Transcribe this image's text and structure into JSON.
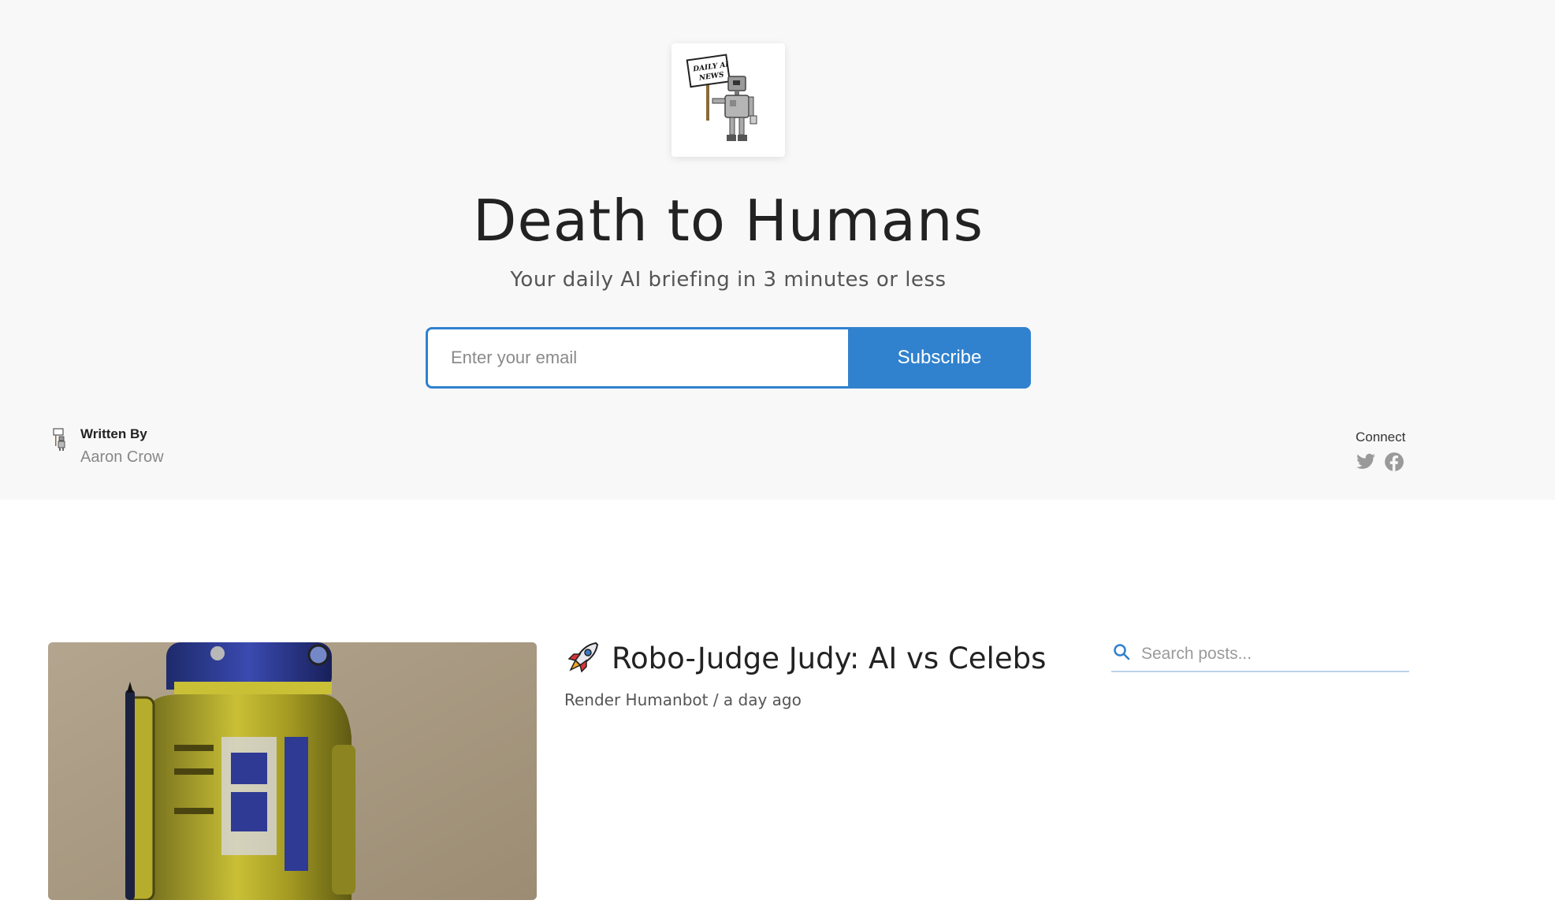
{
  "publication": {
    "logo": {
      "icon": "robot-holding-sign-logo",
      "sign_text": "DAILY AI NEWS"
    },
    "title": "Death to Humans",
    "tagline": "Your daily AI briefing in 3 minutes or less"
  },
  "subscribe": {
    "email_placeholder": "Enter your email",
    "email_value": "",
    "button_label": "Subscribe",
    "accent_color": "#3182ce"
  },
  "author": {
    "label": "Written By",
    "name": "Aaron Crow",
    "avatar_icon": "robot-avatar"
  },
  "connect": {
    "label": "Connect",
    "icons": [
      "twitter-icon",
      "facebook-icon"
    ]
  },
  "posts": [
    {
      "emoji_icon": "rocket-icon",
      "title": "Robo-Judge Judy: AI vs Celebs",
      "meta": "Render Humanbot / a day ago",
      "image_icon": "robot-figure-image"
    }
  ],
  "search": {
    "placeholder": "Search posts...",
    "value": ""
  }
}
